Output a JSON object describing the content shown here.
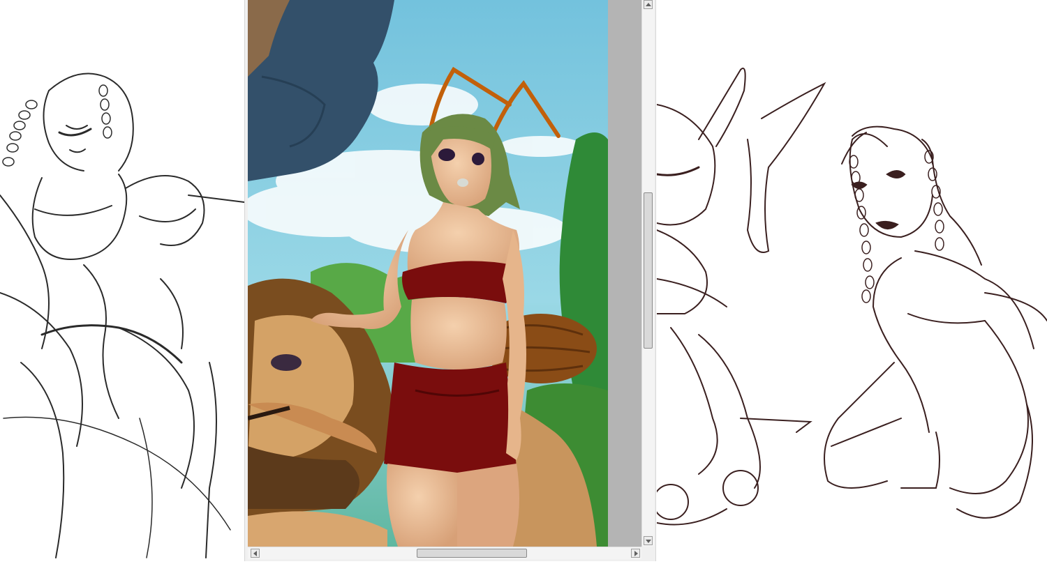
{
  "colors": {
    "sky": "#7ec3de",
    "hair": "#6b8a45",
    "outfit": "#7a0d0d",
    "skin": "#efc49b",
    "sketch_ink_left": "#2a2a2a",
    "sketch_ink_right": "#3a1f1f",
    "scrollbar": "#f4f4f4"
  },
  "viewer": {
    "vertical_scroll": {
      "up_icon": "arrow-up-icon",
      "down_icon": "arrow-down-icon",
      "position": 0.5
    },
    "horizontal_scroll": {
      "left_icon": "arrow-left-icon",
      "right_icon": "arrow-right-icon",
      "position": 0.5
    }
  }
}
